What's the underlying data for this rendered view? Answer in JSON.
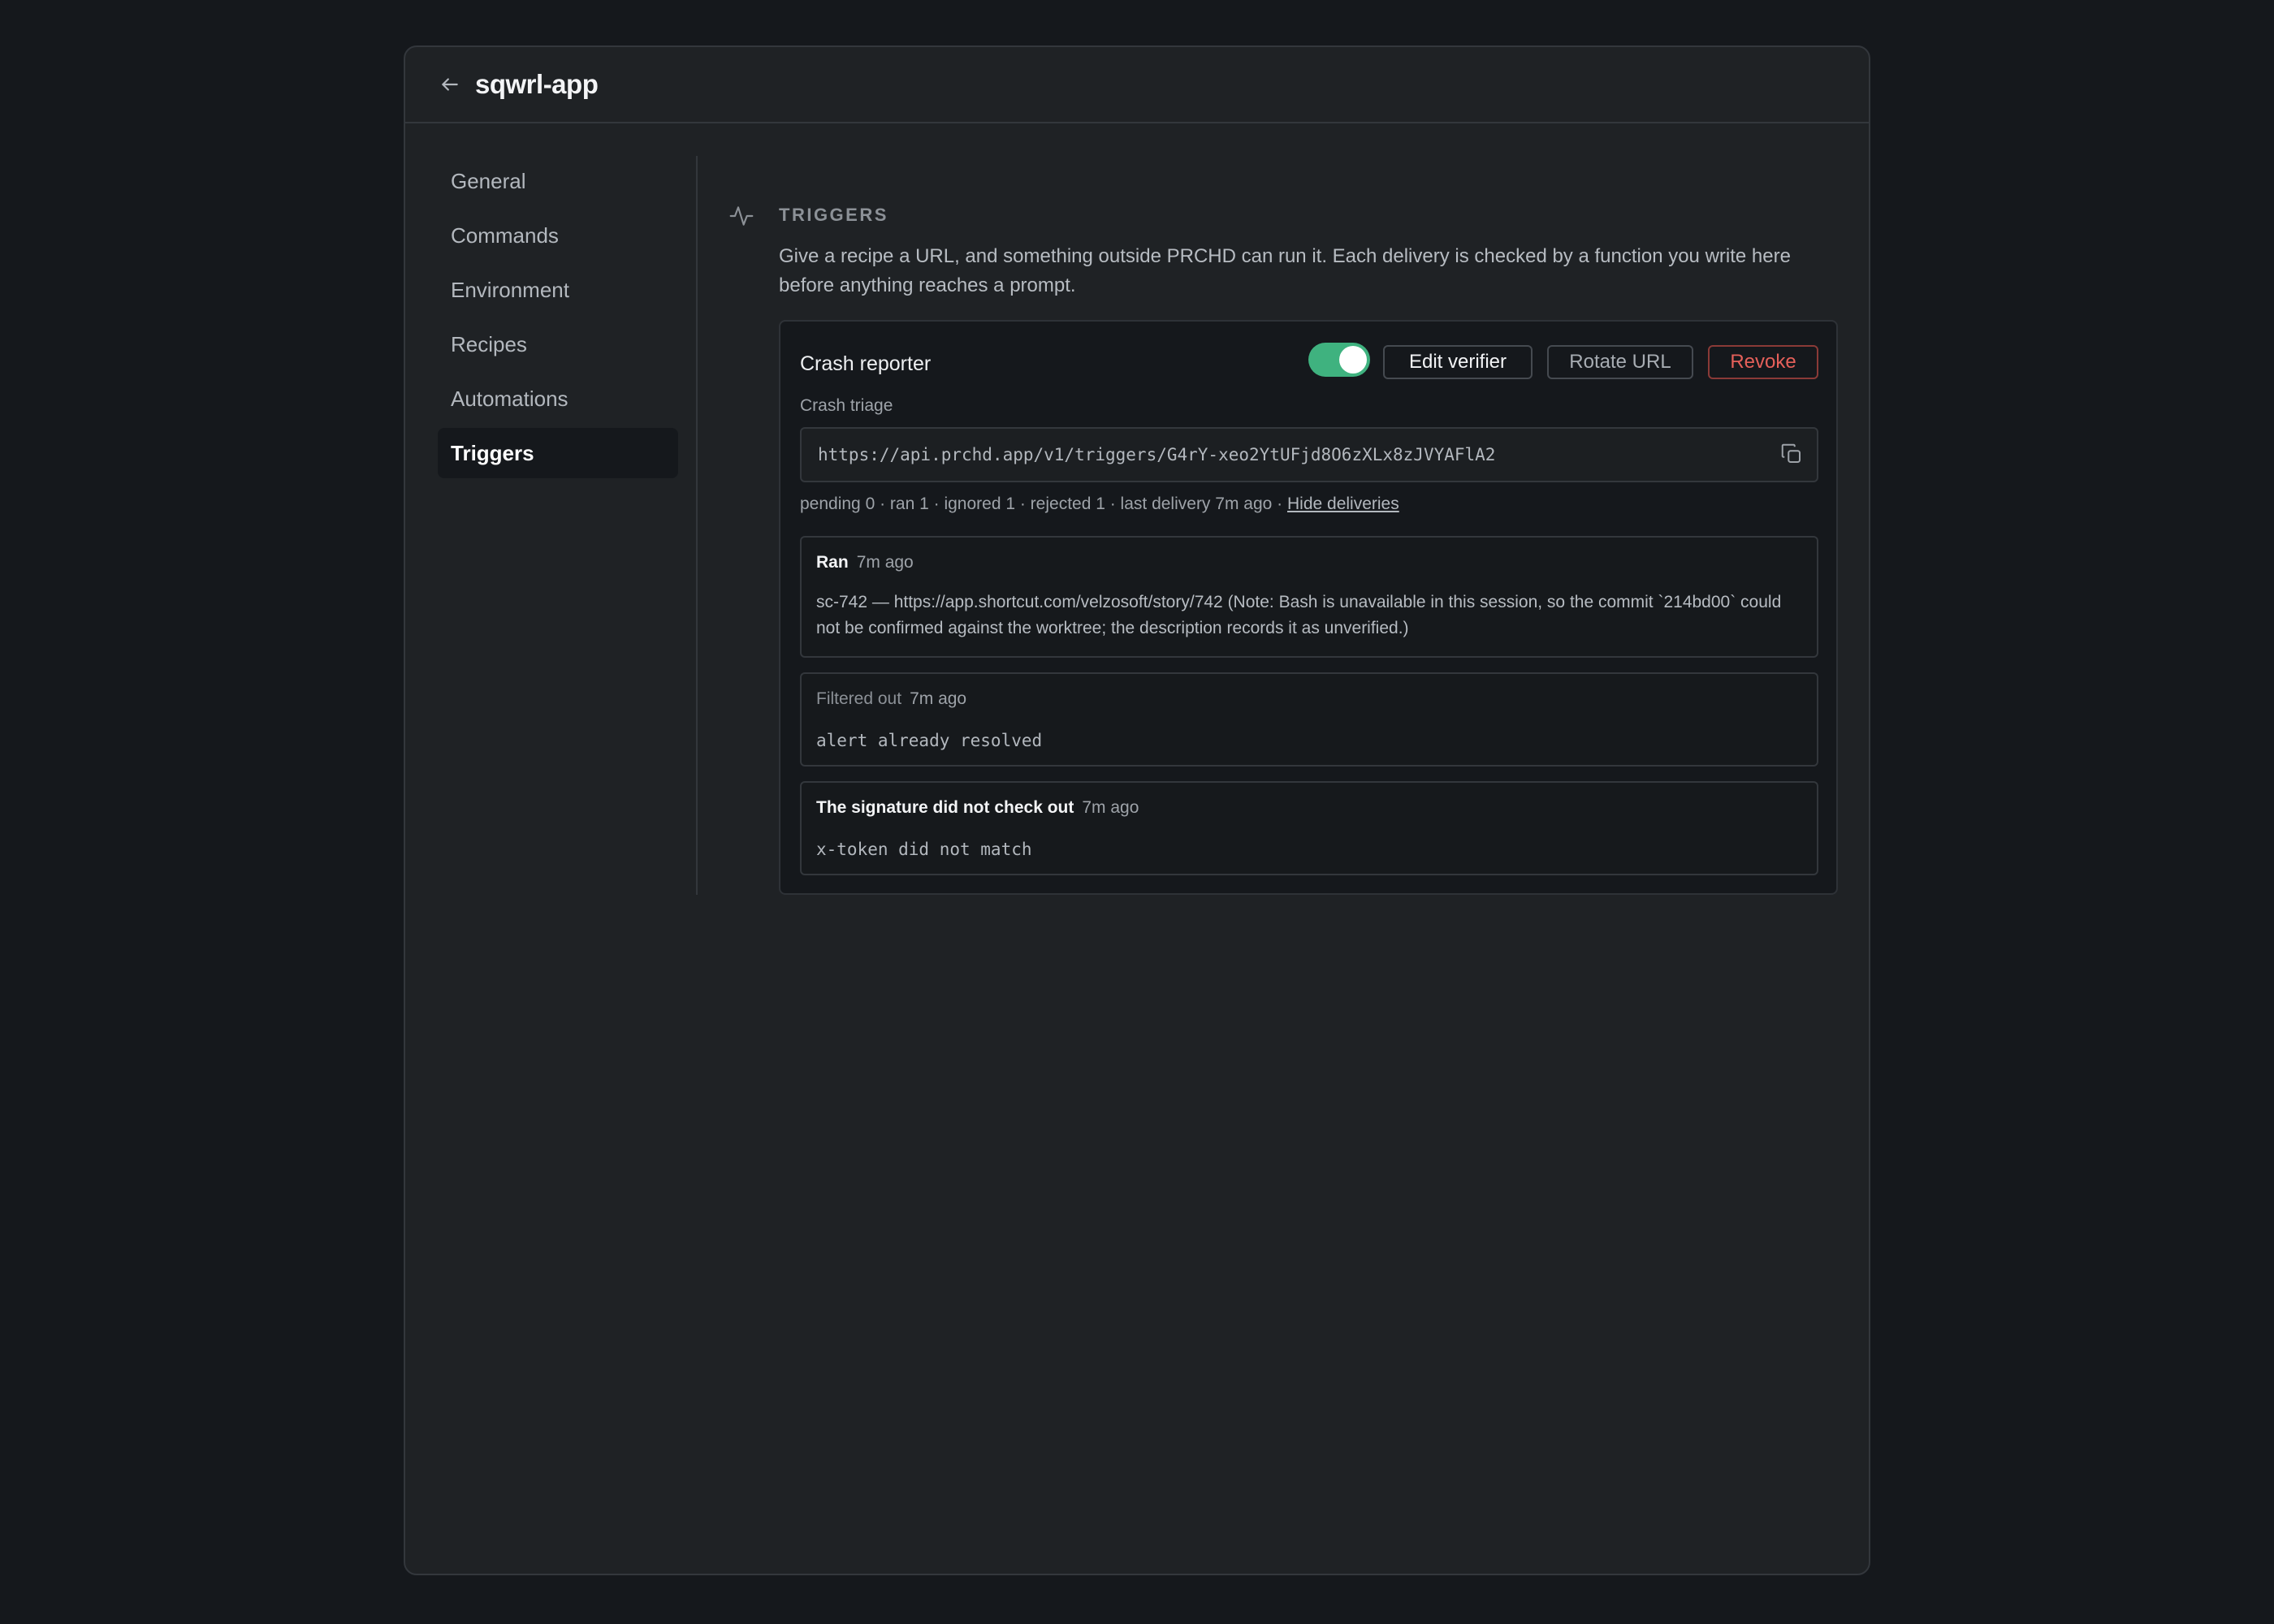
{
  "header": {
    "title": "sqwrl-app"
  },
  "sidebar": {
    "items": [
      {
        "label": "General"
      },
      {
        "label": "Commands"
      },
      {
        "label": "Environment"
      },
      {
        "label": "Recipes"
      },
      {
        "label": "Automations"
      },
      {
        "label": "Triggers",
        "active": true
      }
    ]
  },
  "section": {
    "icon": "activity-icon",
    "title": "TRIGGERS",
    "description": "Give a recipe a URL, and something outside PRCHD can run it. Each delivery is checked by a function you write here before anything reaches a prompt."
  },
  "trigger": {
    "name": "Crash reporter",
    "enabled": true,
    "recipe": "Crash triage",
    "url": "https://api.prchd.app/v1/triggers/G4rY-xeo2YtUFjd8O6zXLx8zJVYAFlA2",
    "buttons": {
      "edit": "Edit verifier",
      "rotate": "Rotate URL",
      "revoke": "Revoke"
    },
    "stats": "pending 0 · ran 1 · ignored 1 · rejected 1 · last delivery 7m ago ·",
    "hide_link": "Hide deliveries",
    "deliveries": [
      {
        "status": "Ran",
        "time": "7m ago",
        "body": "sc-742 — https://app.shortcut.com/velzosoft/story/742 (Note: Bash is unavailable in this session, so the commit `214bd00` could not be confirmed against the worktree; the description records it as unverified.)"
      },
      {
        "status": "Filtered out",
        "time": "7m ago",
        "body": "alert already resolved"
      },
      {
        "status": "The signature did not check out",
        "time": "7m ago",
        "body": "x-token did not match"
      }
    ]
  },
  "colors": {
    "accent_toggle": "#3fb27f",
    "danger": "#e5605a",
    "background": "#15181c",
    "panel": "#1f2225"
  }
}
